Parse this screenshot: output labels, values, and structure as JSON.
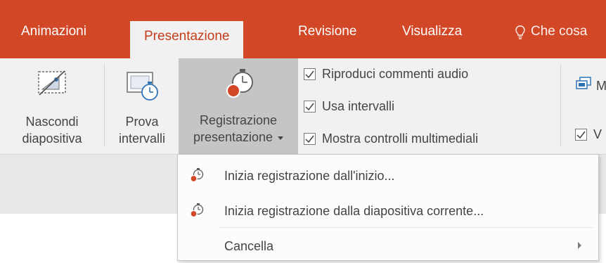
{
  "tabs": [
    {
      "label": "Animazioni"
    },
    {
      "label": "Presentazione"
    },
    {
      "label": "Revisione"
    },
    {
      "label": "Visualizza"
    }
  ],
  "tell_me": {
    "label": "Che cosa"
  },
  "ribbon": {
    "hide_slide": {
      "line1": "Nascondi",
      "line2": "diapositiva"
    },
    "rehearse": {
      "line1": "Prova",
      "line2": "intervalli"
    },
    "record": {
      "line1": "Registrazione",
      "line2": "presentazione"
    },
    "options": [
      {
        "label": "Riproduci commenti audio",
        "checked": true
      },
      {
        "label": "Usa intervalli",
        "checked": true
      },
      {
        "label": "Mostra controlli multimediali",
        "checked": true
      }
    ],
    "right_partial_1": "M",
    "right_partial_2": "V"
  },
  "menu": {
    "items": [
      {
        "label": "Inizia registrazione dall'inizio...",
        "icon": "record-timer-icon"
      },
      {
        "label": "Inizia registrazione dalla diapositiva corrente...",
        "icon": "record-timer-icon"
      },
      {
        "label": "Cancella",
        "icon": "",
        "submenu": true
      }
    ]
  },
  "colors": {
    "accent": "#d24726",
    "active_tab_text": "#c43e1c",
    "ribbon_bg": "#f1f1f1",
    "pressed": "#c5c5c5"
  }
}
